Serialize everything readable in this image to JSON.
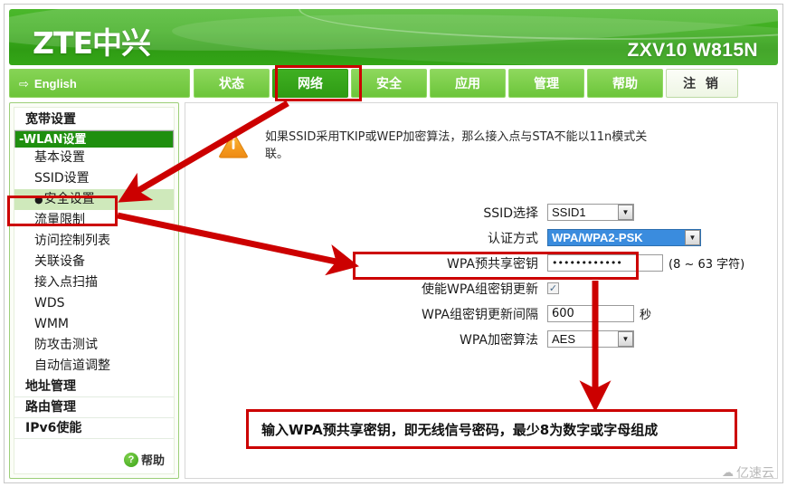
{
  "header": {
    "brand": "ZTE中兴",
    "model": "ZXV10 W815N"
  },
  "nav": {
    "language_label": "English",
    "language_icon": "arrow-right-icon",
    "tabs": [
      {
        "label": "状态",
        "active": false
      },
      {
        "label": "网络",
        "active": true
      },
      {
        "label": "安全",
        "active": false
      },
      {
        "label": "应用",
        "active": false
      },
      {
        "label": "管理",
        "active": false
      },
      {
        "label": "帮助",
        "active": false
      }
    ],
    "logout_label": "注 销"
  },
  "sidebar": {
    "items": [
      {
        "label": "宽带设置",
        "type": "head"
      },
      {
        "label": "-WLAN设置",
        "type": "head",
        "selected": true
      },
      {
        "label": "基本设置",
        "type": "sub"
      },
      {
        "label": "SSID设置",
        "type": "sub"
      },
      {
        "label": "安全设置",
        "type": "sub",
        "current": true,
        "bullet": "●"
      },
      {
        "label": "流量限制",
        "type": "sub"
      },
      {
        "label": "访问控制列表",
        "type": "sub"
      },
      {
        "label": "关联设备",
        "type": "sub"
      },
      {
        "label": "接入点扫描",
        "type": "sub"
      },
      {
        "label": "WDS",
        "type": "sub"
      },
      {
        "label": "WMM",
        "type": "sub"
      },
      {
        "label": "防攻击测试",
        "type": "sub"
      },
      {
        "label": "自动信道调整",
        "type": "sub"
      },
      {
        "label": "地址管理",
        "type": "head"
      },
      {
        "label": "路由管理",
        "type": "head"
      },
      {
        "label": "IPv6使能",
        "type": "head"
      }
    ],
    "help": {
      "icon": "question-mark-icon",
      "icon_char": "?",
      "label": "帮助"
    }
  },
  "content": {
    "warning": {
      "icon": "warning-triangle-icon",
      "text": "如果SSID采用TKIP或WEP加密算法，那么接入点与STA不能以11n模式关联。"
    },
    "fields": {
      "ssid_select": {
        "label": "SSID选择",
        "value": "SSID1"
      },
      "auth_mode": {
        "label": "认证方式",
        "value": "WPA/WPA2-PSK",
        "highlighted": true
      },
      "wpa_psk": {
        "label": "WPA预共享密钥",
        "value": "••••••••••••",
        "hint": "(8 ~ 63 字符)"
      },
      "enable_group_key": {
        "label": "使能WPA组密钥更新",
        "checked": true,
        "check_char": "✓"
      },
      "group_key_interval": {
        "label": "WPA组密钥更新间隔",
        "value": "600",
        "unit": "秒"
      },
      "wpa_cipher": {
        "label": "WPA加密算法",
        "value": "AES"
      }
    }
  },
  "annotations": {
    "note": "输入WPA预共享密钥，即无线信号密码，最少8为数字或字母组成",
    "color": "#cc0000"
  },
  "watermark": {
    "icon": "cloud-icon",
    "text": "亿速云"
  }
}
